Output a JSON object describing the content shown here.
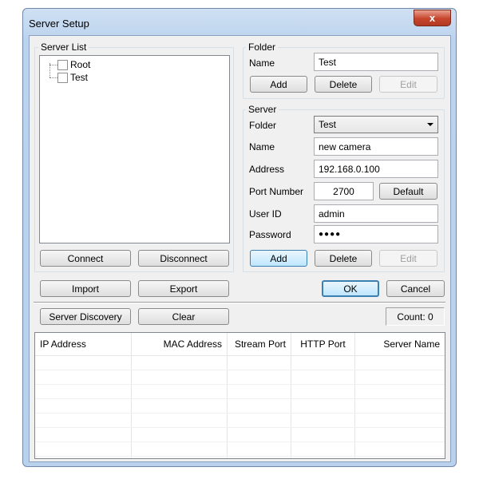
{
  "window": {
    "title": "Server Setup",
    "close_glyph": "x"
  },
  "server_list": {
    "label": "Server List",
    "items": [
      {
        "label": "Root"
      },
      {
        "label": "Test"
      }
    ],
    "connect_label": "Connect",
    "disconnect_label": "Disconnect"
  },
  "folder": {
    "label": "Folder",
    "name_label": "Name",
    "name_value": "Test",
    "add_label": "Add",
    "delete_label": "Delete",
    "edit_label": "Edit"
  },
  "server": {
    "label": "Server",
    "folder_label": "Folder",
    "folder_value": "Test",
    "name_label": "Name",
    "name_value": "new camera",
    "address_label": "Address",
    "address_value": "192.168.0.100",
    "port_label": "Port Number",
    "port_value": "2700",
    "default_label": "Default",
    "userid_label": "User ID",
    "userid_value": "admin",
    "password_label": "Password",
    "password_value": "●●●●",
    "add_label": "Add",
    "delete_label": "Delete",
    "edit_label": "Edit"
  },
  "actions": {
    "import_label": "Import",
    "export_label": "Export",
    "ok_label": "OK",
    "cancel_label": "Cancel"
  },
  "discovery": {
    "discovery_label": "Server Discovery",
    "clear_label": "Clear",
    "count_text": "Count: 0"
  },
  "table": {
    "columns": [
      "IP Address",
      "MAC Address",
      "Stream Port",
      "HTTP Port",
      "Server Name"
    ]
  }
}
